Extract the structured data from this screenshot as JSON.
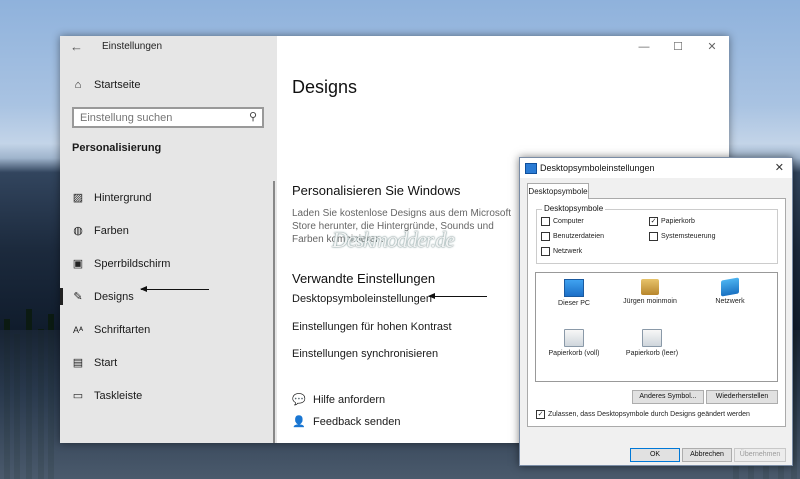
{
  "settings": {
    "title": "Einstellungen",
    "back_glyph": "←",
    "home": "Startseite",
    "search_placeholder": "Einstellung suchen",
    "section": "Personalisierung",
    "nav": [
      {
        "label": "Hintergrund",
        "icon": "picture-icon",
        "glyph": "▨",
        "active": false
      },
      {
        "label": "Farben",
        "icon": "palette-icon",
        "glyph": "◍",
        "active": false
      },
      {
        "label": "Sperrbildschirm",
        "icon": "lock-screen-icon",
        "glyph": "▣",
        "active": false
      },
      {
        "label": "Designs",
        "icon": "brush-icon",
        "glyph": "✎",
        "active": true
      },
      {
        "label": "Schriftarten",
        "icon": "font-icon",
        "glyph": "Aᴬ",
        "active": false
      },
      {
        "label": "Start",
        "icon": "start-icon",
        "glyph": "▤",
        "active": false
      },
      {
        "label": "Taskleiste",
        "icon": "taskbar-icon",
        "glyph": "▭",
        "active": false
      }
    ],
    "page_title": "Designs",
    "personalize_heading": "Personalisieren Sie Windows",
    "personalize_desc": "Laden Sie kostenlose Designs aus dem Microsoft Store herunter, die Hintergründe, Sounds und Farben kombinieren.",
    "related_heading": "Verwandte Einstellungen",
    "links": [
      "Desktopsymboleinstellungen",
      "Einstellungen für hohen Kontrast",
      "Einstellungen synchronisieren"
    ],
    "help": "Hilfe anfordern",
    "feedback": "Feedback senden"
  },
  "watermark": "Deskmodder.de",
  "dialog": {
    "title": "Desktopsymboleinstellungen",
    "tab": "Desktopsymbole",
    "group_label": "Desktopsymbole",
    "checkboxes": [
      {
        "label": "Computer",
        "checked": false
      },
      {
        "label": "Papierkorb",
        "checked": true
      },
      {
        "label": "Benutzerdateien",
        "checked": false
      },
      {
        "label": "Systemsteuerung",
        "checked": false
      },
      {
        "label": "Netzwerk",
        "checked": false
      }
    ],
    "icons": [
      "Dieser PC",
      "Jürgen moinmoin",
      "Netzwerk",
      "Papierkorb (voll)",
      "Papierkorb (leer)"
    ],
    "change_icon": "Anderes Symbol...",
    "restore": "Wiederherstellen",
    "allow_label": "Zulassen, dass Desktopsymbole durch Designs geändert werden",
    "allow_checked": true,
    "ok": "OK",
    "cancel": "Abbrechen",
    "apply": "Übernehmen"
  }
}
